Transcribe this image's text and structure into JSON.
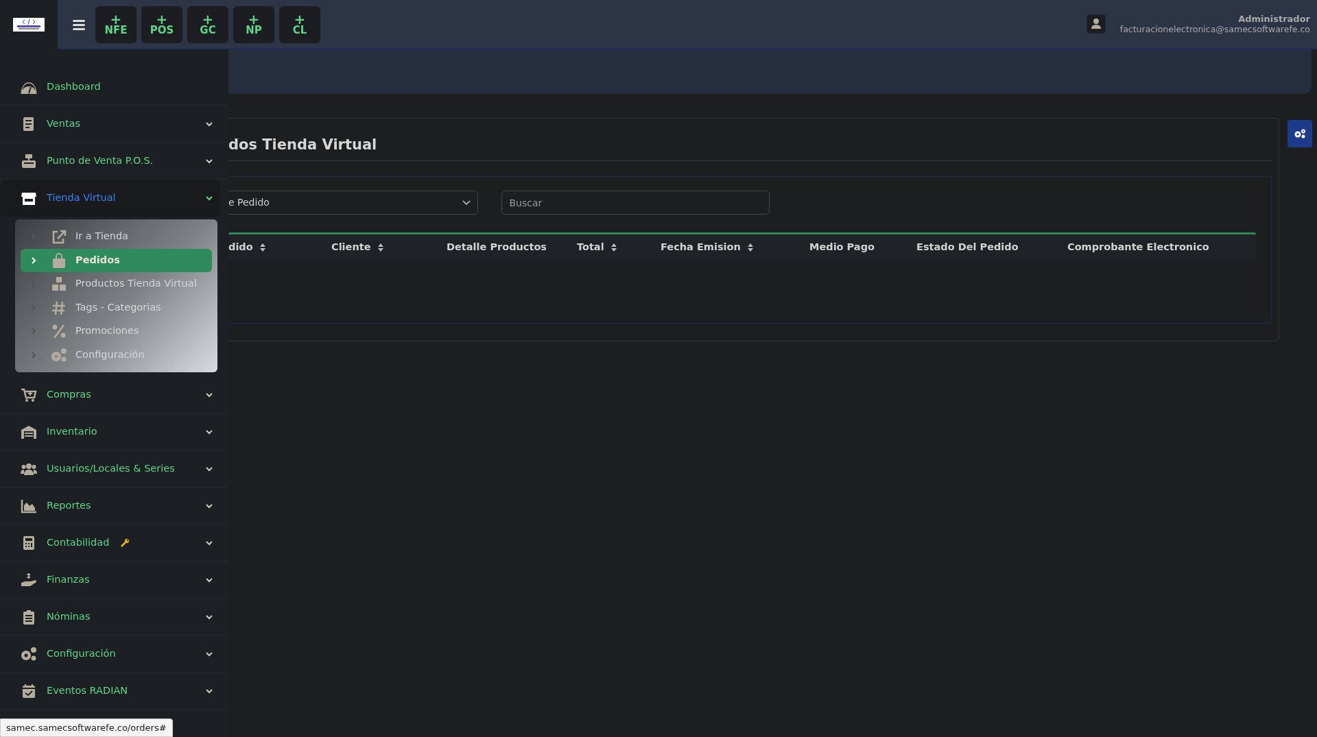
{
  "header": {
    "quick_actions": [
      {
        "symbol": "+",
        "label": "NFE"
      },
      {
        "symbol": "+",
        "label": "POS"
      },
      {
        "symbol": "+",
        "label": "GC"
      },
      {
        "symbol": "+",
        "label": "NP"
      },
      {
        "symbol": "+",
        "label": "CL"
      }
    ],
    "user": {
      "name": "Administrador",
      "email": "facturacionelectronica@samecsoftwarefe.co"
    }
  },
  "sidebar": {
    "items": [
      {
        "label": "Dashboard",
        "expandable": false,
        "selected": false
      },
      {
        "label": "Ventas",
        "expandable": true,
        "selected": false
      },
      {
        "label": "Punto de Venta P.O.S.",
        "expandable": true,
        "selected": false
      },
      {
        "label": "Tienda Virtual",
        "expandable": true,
        "selected": true,
        "children": [
          {
            "label": "Ir a Tienda",
            "selected": false
          },
          {
            "label": "Pedidos",
            "selected": true
          },
          {
            "label": "Productos Tienda Virtual",
            "selected": false
          },
          {
            "label": "Tags - Categorias",
            "selected": false
          },
          {
            "label": "Promociones",
            "selected": false
          },
          {
            "label": "Configuración",
            "selected": false
          }
        ]
      },
      {
        "label": "Compras",
        "expandable": true,
        "selected": false
      },
      {
        "label": "Inventario",
        "expandable": true,
        "selected": false
      },
      {
        "label": "Usuarios/Locales & Series",
        "expandable": true,
        "selected": false
      },
      {
        "label": "Reportes",
        "expandable": true,
        "selected": false
      },
      {
        "label": "Contabilidad",
        "expandable": true,
        "selected": false,
        "wrench": true
      },
      {
        "label": "Finanzas",
        "expandable": true,
        "selected": false
      },
      {
        "label": "Nóminas",
        "expandable": true,
        "selected": false
      },
      {
        "label": "Configuración",
        "expandable": true,
        "selected": false
      },
      {
        "label": "Eventos RADIAN",
        "expandable": true,
        "selected": false
      }
    ]
  },
  "page": {
    "title": "dos Tienda Virtual",
    "filter": {
      "value": "e Pedido"
    },
    "search": {
      "placeholder": "Buscar"
    },
    "table": {
      "columns": [
        {
          "label": "dido",
          "sortable": true
        },
        {
          "label": "Cliente",
          "sortable": true
        },
        {
          "label": "Detalle Productos",
          "sortable": false
        },
        {
          "label": "Total",
          "sortable": true
        },
        {
          "label": "Fecha Emision",
          "sortable": true
        },
        {
          "label": "Medio Pago",
          "sortable": false
        },
        {
          "label": "Estado Del Pedido",
          "sortable": false
        },
        {
          "label": "Comprobante Electronico",
          "sortable": false
        }
      ]
    }
  },
  "status_bar": {
    "url": "samec.samecsoftwarefe.co/orders#"
  }
}
